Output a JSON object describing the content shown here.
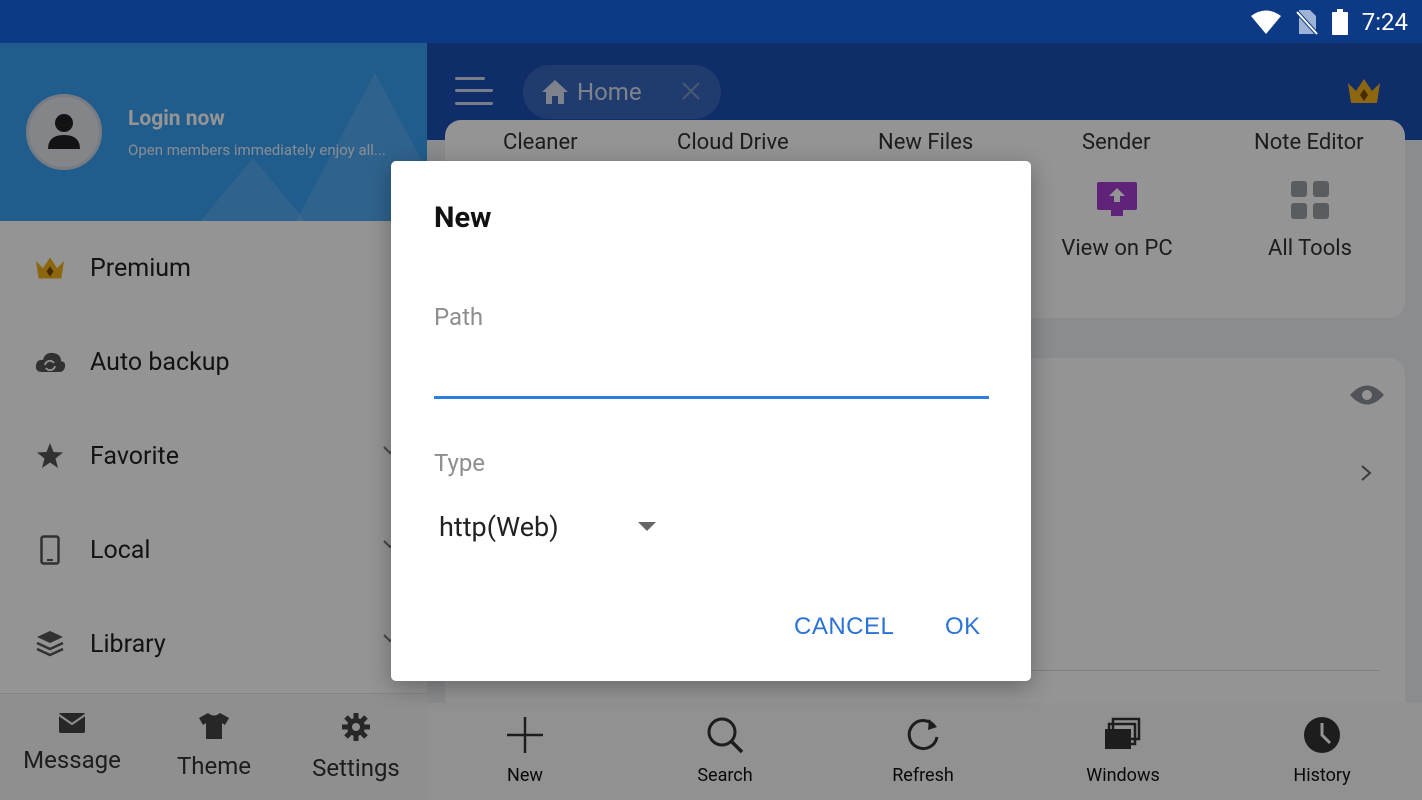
{
  "status_bar": {
    "time": "7:24"
  },
  "top_bar": {
    "home_tab": "Home"
  },
  "content": {
    "row_labels": [
      "Cleaner",
      "Cloud Drive",
      "New Files",
      "Sender",
      "Note Editor"
    ],
    "tools": [
      {
        "label": "View on PC",
        "icon": "monitor-icon",
        "color": "#a83bd3"
      },
      {
        "label": "All Tools",
        "icon": "grid-icon",
        "color": "#9aa0a6"
      }
    ]
  },
  "bottom_bar": {
    "items": [
      {
        "label": "New",
        "icon": "plus-icon"
      },
      {
        "label": "Search",
        "icon": "search-icon"
      },
      {
        "label": "Refresh",
        "icon": "refresh-icon"
      },
      {
        "label": "Windows",
        "icon": "windows-icon"
      },
      {
        "label": "History",
        "icon": "clock-icon"
      }
    ]
  },
  "drawer": {
    "login_title": "Login now",
    "login_subtitle": "Open members immediately enjoy all...",
    "items": [
      {
        "label": "Premium",
        "icon": "crown-icon"
      },
      {
        "label": "Auto backup",
        "icon": "cloud-sync-icon"
      },
      {
        "label": "Favorite",
        "icon": "star-icon"
      },
      {
        "label": "Local",
        "icon": "phone-icon"
      },
      {
        "label": "Library",
        "icon": "layers-icon"
      }
    ],
    "bottom": [
      {
        "label": "Message",
        "icon": "mail-icon"
      },
      {
        "label": "Theme",
        "icon": "shirt-icon"
      },
      {
        "label": "Settings",
        "icon": "gear-icon"
      }
    ]
  },
  "dialog": {
    "title": "New",
    "path_label": "Path",
    "path_value": "",
    "type_label": "Type",
    "type_value": "http(Web)",
    "cancel_label": "CANCEL",
    "ok_label": "OK"
  },
  "colors": {
    "primary": "#1a50b5",
    "status_bar": "#0d3a86",
    "accent": "#2b73d6",
    "drawer_header": "#3aa0f2"
  }
}
